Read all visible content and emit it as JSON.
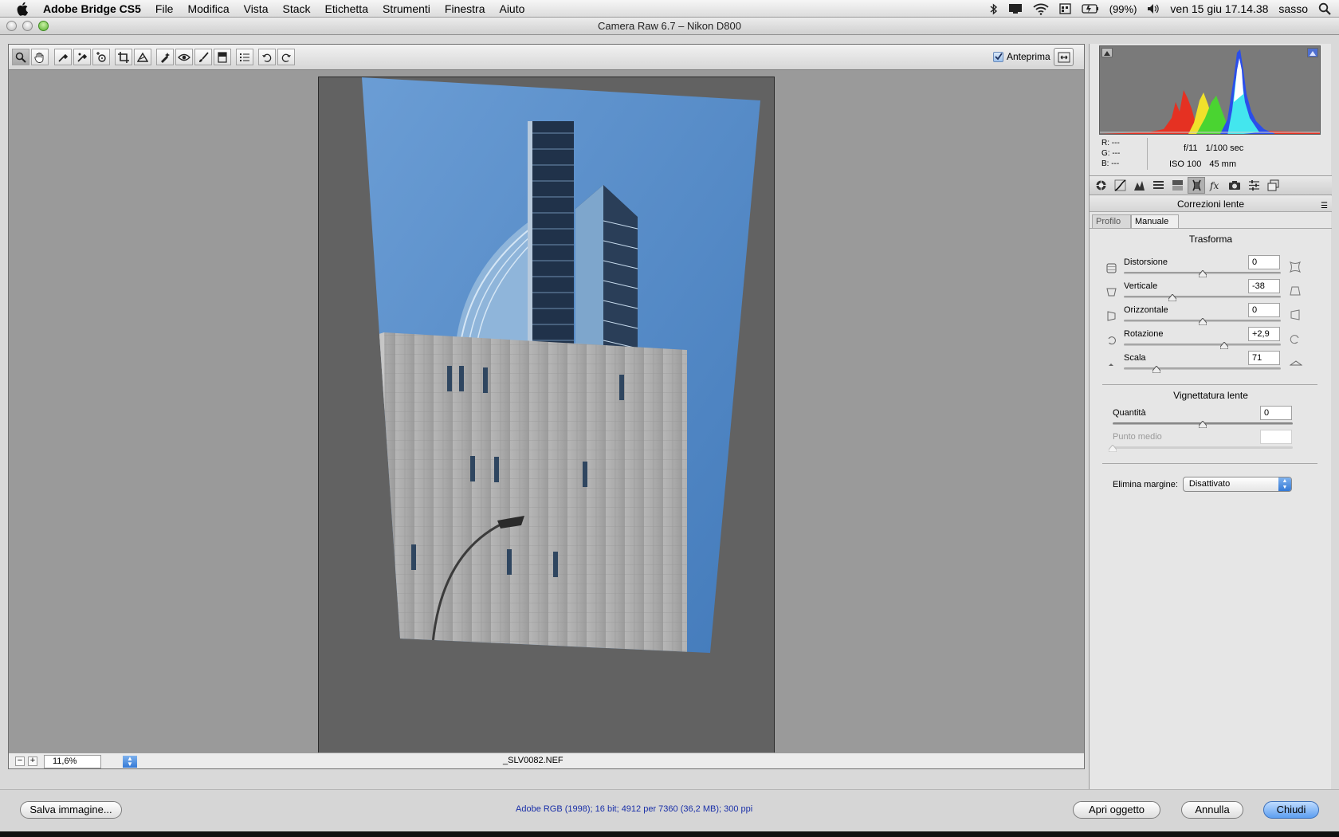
{
  "menubar": {
    "app_name": "Adobe Bridge CS5",
    "items": [
      "File",
      "Modifica",
      "Vista",
      "Stack",
      "Etichetta",
      "Strumenti",
      "Finestra",
      "Aiuto"
    ],
    "battery": "(99%)",
    "datetime": "ven 15 giu  17.14.38",
    "user": "sasso"
  },
  "window": {
    "title": "Camera Raw 6.7  –  Nikon D800"
  },
  "toolbar": {
    "tools": [
      "zoom-tool",
      "hand-tool",
      "white-balance-tool",
      "color-sampler-tool",
      "targeted-adjustment-tool",
      "crop-tool",
      "straighten-tool",
      "spot-removal-tool",
      "red-eye-tool",
      "adjustment-brush-tool",
      "graduated-filter-tool",
      "preferences-tool",
      "rotate-ccw-tool",
      "rotate-cw-tool"
    ],
    "preview_label": "Anteprima",
    "preview_checked": true
  },
  "status": {
    "zoom": "11,6%",
    "filename": "_SLV0082.NEF"
  },
  "panel": {
    "rgb": {
      "r": "R:  ---",
      "g": "G:  ---",
      "b": "B:  ---"
    },
    "exif": {
      "aperture": "f/11",
      "shutter": "1/100 sec",
      "iso": "ISO 100",
      "focal": "45 mm"
    },
    "title": "Correzioni lente",
    "tabs": [
      "Profilo",
      "Manuale"
    ],
    "active_tab": "Manuale",
    "transform": {
      "title": "Trasforma",
      "sliders": [
        {
          "label": "Distorsione",
          "value": "0",
          "position": 0.5
        },
        {
          "label": "Verticale",
          "value": "-38",
          "position": 0.31
        },
        {
          "label": "Orizzontale",
          "value": "0",
          "position": 0.5
        },
        {
          "label": "Rotazione",
          "value": "+2,9",
          "position": 0.64
        },
        {
          "label": "Scala",
          "value": "71",
          "position": 0.21
        }
      ]
    },
    "vignette": {
      "title": "Vignettatura lente",
      "amount": {
        "label": "Quantità",
        "value": "0",
        "position": 0.5
      },
      "midpoint": {
        "label": "Punto medio",
        "value": "",
        "position": 0.0
      }
    },
    "defringe": {
      "label": "Elimina margine:",
      "value": "Disattivato"
    }
  },
  "bottom": {
    "save_label": "Salva immagine...",
    "workflow": "Adobe RGB (1998); 16 bit; 4912 per 7360 (36,2 MB); 300 ppi",
    "open_label": "Apri oggetto",
    "cancel_label": "Annulla",
    "close_label": "Chiudi"
  },
  "colors": {
    "accent": "#3479d6",
    "workspace": "#9a9a9a",
    "canvas": "#626262",
    "sky": "#5b8fc9"
  }
}
